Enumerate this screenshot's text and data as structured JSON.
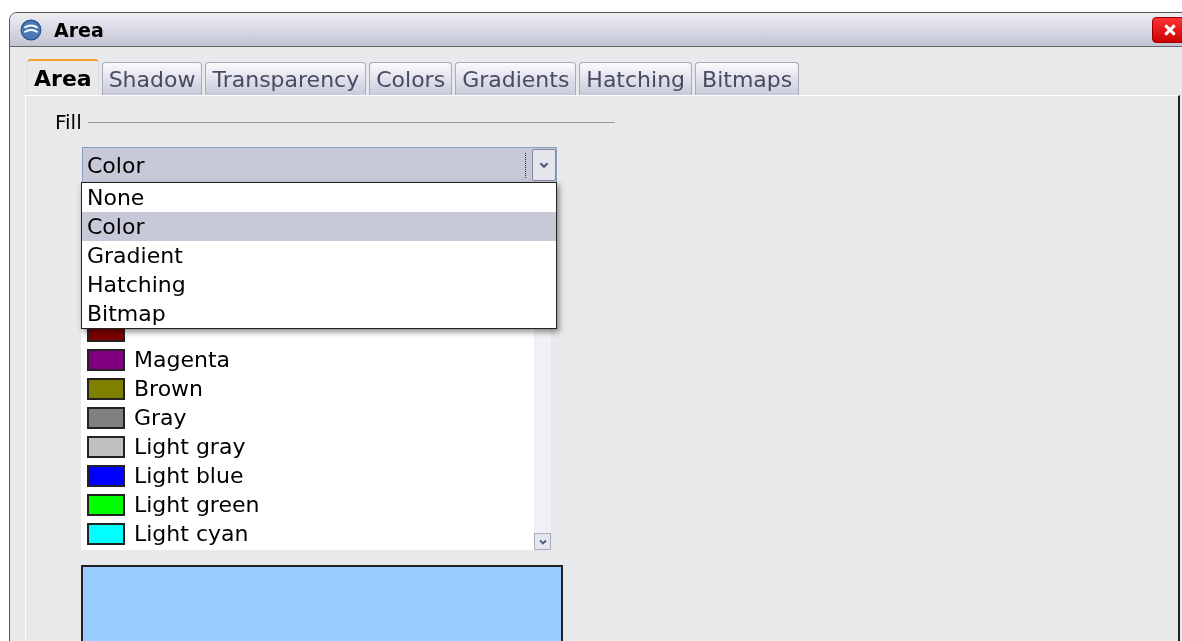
{
  "window": {
    "title": "Area"
  },
  "tabs": [
    {
      "label": "Area",
      "selected": true
    },
    {
      "label": "Shadow",
      "selected": false
    },
    {
      "label": "Transparency",
      "selected": false
    },
    {
      "label": "Colors",
      "selected": false
    },
    {
      "label": "Gradients",
      "selected": false
    },
    {
      "label": "Hatching",
      "selected": false
    },
    {
      "label": "Bitmaps",
      "selected": false
    }
  ],
  "fill": {
    "label": "Fill",
    "combo_value": "Color",
    "dropdown": [
      {
        "label": "None",
        "selected": false
      },
      {
        "label": "Color",
        "selected": true
      },
      {
        "label": "Gradient",
        "selected": false
      },
      {
        "label": "Hatching",
        "selected": false
      },
      {
        "label": "Bitmap",
        "selected": false
      }
    ],
    "colors": [
      {
        "color": "#800000"
      },
      {
        "name": "Magenta",
        "color": "#800080"
      },
      {
        "name": "Brown",
        "color": "#808000"
      },
      {
        "name": "Gray",
        "color": "#808080"
      },
      {
        "name": "Light gray",
        "color": "#c0c0c0"
      },
      {
        "name": "Light blue",
        "color": "#0000ff"
      },
      {
        "name": "Light green",
        "color": "#00ff00"
      },
      {
        "name": "Light cyan",
        "color": "#00ffff"
      }
    ]
  }
}
